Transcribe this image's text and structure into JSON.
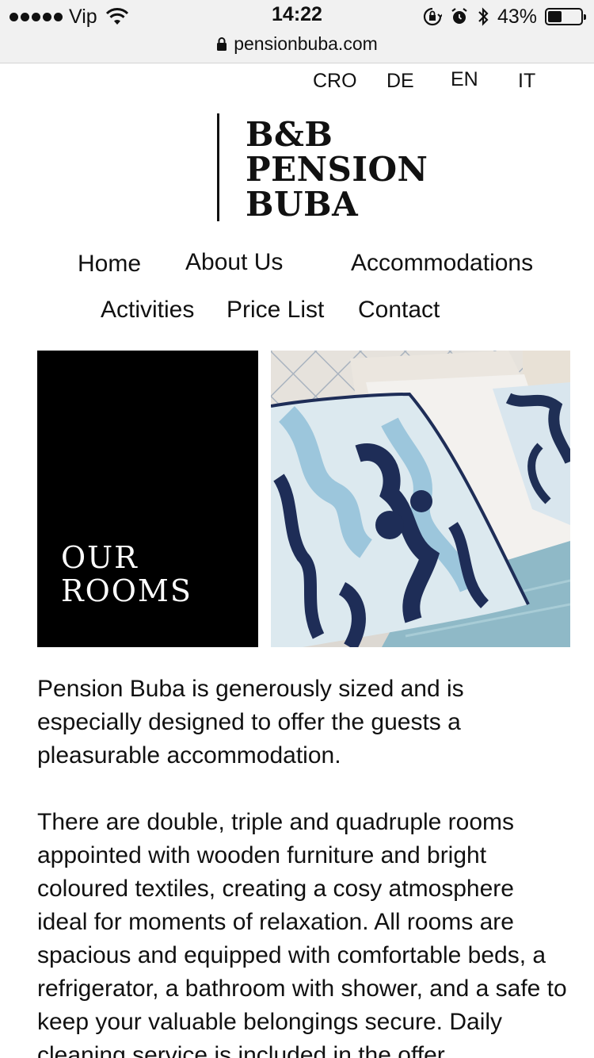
{
  "status_bar": {
    "carrier": "Vip",
    "time": "14:22",
    "battery_percent": "43%",
    "battery_level": 0.43,
    "icons": [
      "signal-dots-icon",
      "wifi-icon",
      "rotation-lock-icon",
      "alarm-icon",
      "bluetooth-icon",
      "battery-icon"
    ]
  },
  "browser": {
    "url": "pensionbuba.com",
    "lock_icon": "lock-icon"
  },
  "languages": [
    "CRO",
    "DE",
    "EN",
    "IT"
  ],
  "logo": {
    "line1": "B&B",
    "line2": "PENSION",
    "line3": "BUBA"
  },
  "nav": {
    "home": "Home",
    "about": "About Us",
    "accommodations": "Accommodations",
    "activities": "Activities",
    "price_list": "Price List",
    "contact": "Contact"
  },
  "hero": {
    "title_line1": "OUR",
    "title_line2": "ROOMS",
    "photo": "bed-with-ikat-pillows-photo"
  },
  "content": {
    "paragraph1": "Pension Buba is generously sized and is especially designed to offer the guests a pleasurable accommodation.",
    "paragraph2": "There are double, triple and quadruple rooms appointed with wooden furniture and bright coloured textiles, creating a cosy atmosphere ideal for moments of relaxation. All rooms are spacious and equipped with comfortable beds, a refrigerator, a bathroom with shower, and a safe to keep your valuable belongings secure. Daily cleaning service is included in the offer."
  },
  "colors": {
    "background": "#ffffff",
    "text": "#111111",
    "hero_box": "#000000",
    "status_bar": "#f1f1f1"
  }
}
